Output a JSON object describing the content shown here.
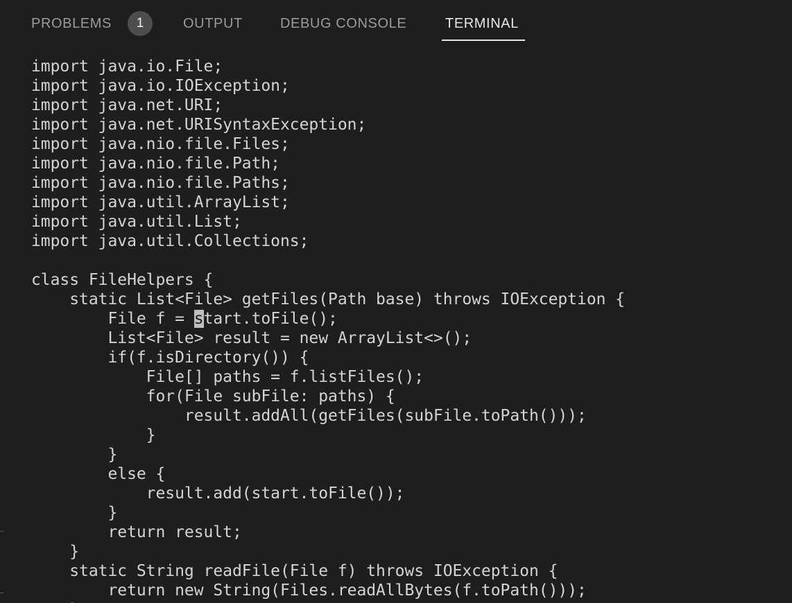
{
  "tabs": {
    "problems": "PROBLEMS",
    "problems_count": "1",
    "output": "OUTPUT",
    "debug_console": "DEBUG CONSOLE",
    "terminal": "TERMINAL",
    "active": "terminal"
  },
  "terminal": {
    "lines": [
      "import java.io.File;",
      "import java.io.IOException;",
      "import java.net.URI;",
      "import java.net.URISyntaxException;",
      "import java.nio.file.Files;",
      "import java.nio.file.Path;",
      "import java.nio.file.Paths;",
      "import java.util.ArrayList;",
      "import java.util.List;",
      "import java.util.Collections;",
      "",
      "class FileHelpers {",
      "    static List<File> getFiles(Path base) throws IOException {",
      "        File f = start.toFile();",
      "        List<File> result = new ArrayList<>();",
      "        if(f.isDirectory()) {",
      "            File[] paths = f.listFiles();",
      "            for(File subFile: paths) {",
      "                result.addAll(getFiles(subFile.toPath()));",
      "            }",
      "        }",
      "        else {",
      "            result.add(start.toFile());",
      "        }",
      "        return result;",
      "    }",
      "    static String readFile(File f) throws IOException {",
      "        return new String(Files.readAllBytes(f.toPath()));",
      "    }"
    ],
    "cursor": {
      "line": 13,
      "before": "        File f = ",
      "char": "s",
      "after": "tart.toFile();"
    }
  },
  "colors": {
    "background": "#1e1e1e",
    "text": "#d4d4d4",
    "tab_inactive": "#9b9b9b",
    "tab_active": "#e7e7e7",
    "badge": "#4d4d4d",
    "cursor": "#bfbfbf"
  }
}
